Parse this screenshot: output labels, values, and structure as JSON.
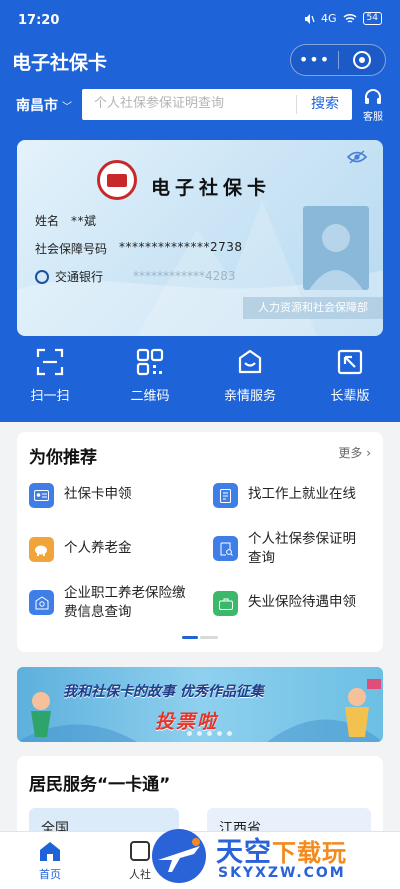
{
  "status_bar": {
    "time": "17:20",
    "network": "4G",
    "battery": "54"
  },
  "header": {
    "title": "电子社保卡",
    "more_label": "•••"
  },
  "search": {
    "city": "南昌市",
    "placeholder": "个人社保参保证明查询",
    "button_label": "搜索",
    "service_label": "客服"
  },
  "card": {
    "title": "电子社保卡",
    "name_label": "姓名",
    "name_value": "**斌",
    "id_label": "社会保障号码",
    "id_value": "**************2738",
    "bank_label": "交通银行",
    "bank_value": "************4283",
    "issuer": "人力资源和社会保障部"
  },
  "actions": [
    {
      "label": "扫一扫",
      "icon": "scan-icon"
    },
    {
      "label": "二维码",
      "icon": "qrcode-icon"
    },
    {
      "label": "亲情服务",
      "icon": "family-service-icon"
    },
    {
      "label": "长辈版",
      "icon": "elder-mode-icon"
    }
  ],
  "recommend": {
    "title": "为你推荐",
    "more": "更多 ›",
    "items": [
      {
        "label": "社保卡申领",
        "icon": "id-card-icon",
        "color": "#3f7ee6"
      },
      {
        "label": "找工作上就业在线",
        "icon": "document-icon",
        "color": "#3f7ee6"
      },
      {
        "label": "个人养老金",
        "icon": "piggy-bank-icon",
        "color": "#f0a43a"
      },
      {
        "label": "个人社保参保证明查询",
        "icon": "certificate-search-icon",
        "color": "#3f7ee6"
      },
      {
        "label": "企业职工养老保险缴费信息查询",
        "icon": "pension-search-icon",
        "color": "#3f7ee6"
      },
      {
        "label": "失业保险待遇申领",
        "icon": "briefcase-icon",
        "color": "#3cb86a"
      }
    ]
  },
  "banner": {
    "line1": "我和社保卡的故事 优秀作品征集",
    "line2": "投票啦"
  },
  "residents": {
    "title": "居民服务“一卡通”",
    "card1": "全国",
    "card2": "江西省"
  },
  "tabbar": {
    "home": "首页",
    "second": "人社"
  },
  "watermark": {
    "text_main": "天空",
    "text_accent": "下载玩",
    "text_sub": "SKYXZW.COM"
  },
  "colors": {
    "primary": "#1f63d8",
    "orange": "#f0a43a",
    "green": "#3cb86a"
  }
}
